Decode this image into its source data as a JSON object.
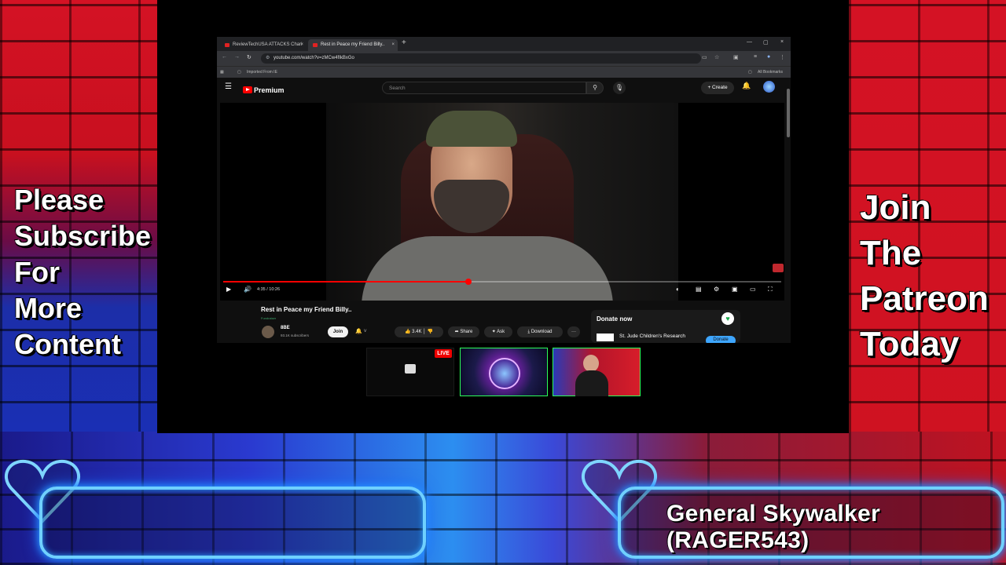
{
  "overlay": {
    "left_text": [
      "Please",
      "Subscribe",
      "For",
      "More",
      "Content"
    ],
    "right_text": [
      "Join",
      "The",
      "Patreon",
      "Today"
    ],
    "name_banner": "General Skywalker (RAGER543)",
    "colors": {
      "neon": "#6fd0ff",
      "brick_red": "#d41224",
      "brick_blue": "#1c2ea8"
    }
  },
  "browser": {
    "tabs": [
      {
        "title": "ReviewTechUSA ATTACKS Chari",
        "close": "×"
      },
      {
        "title": "Rest in Peace my Friend Billy..",
        "close": "×"
      }
    ],
    "new_tab": "+",
    "window_controls": [
      "—",
      "▢",
      "×"
    ],
    "url": "youtube.com/watch?v=zMCw4fIkBxGo",
    "bookmarks": {
      "imported": "Imported From IE",
      "all": "All Bookmarks"
    }
  },
  "youtube": {
    "brand": "Premium",
    "search_placeholder": "Search",
    "create_label": "Create",
    "video": {
      "current_time": "4:35",
      "duration": "10:26",
      "time_display": "4:35 / 10:26",
      "progress_fraction": 0.44
    },
    "title": "Rest in Peace my Friend Billy..",
    "fundraiser_tag": "Fundraiser",
    "channel": {
      "name": "8BE",
      "subscribers": "93.1K subscribers"
    },
    "join_label": "Join",
    "likes": "3.4K",
    "share_label": "Share",
    "ask_label": "Ask",
    "download_label": "Download",
    "more_label": "···",
    "donate": {
      "header": "Donate now",
      "org": "St. Jude Children's Research",
      "button": "Donate"
    }
  },
  "thumbnails": {
    "live_badge": "LIVE"
  },
  "icons": [
    "menu-icon",
    "search-icon",
    "mic-icon",
    "bell-icon",
    "play-icon",
    "volume-icon",
    "settings-icon",
    "fullscreen-icon",
    "like-icon",
    "dislike-icon",
    "share-icon",
    "download-icon",
    "heart-icon"
  ]
}
